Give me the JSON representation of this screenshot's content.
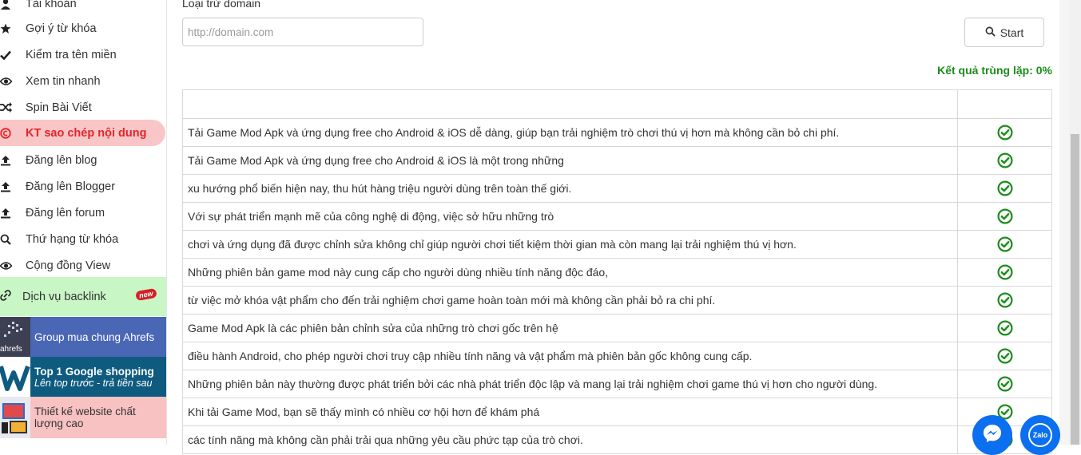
{
  "sidebar": {
    "items": [
      {
        "label": "Tài khoản",
        "icon": "user-icon"
      },
      {
        "label": "Gợi ý từ khóa",
        "icon": "star-icon"
      },
      {
        "label": "Kiểm tra tên miền",
        "icon": "check-icon"
      },
      {
        "label": "Xem tin nhanh",
        "icon": "eye-icon"
      },
      {
        "label": "Spin Bài Viết",
        "icon": "shuffle-icon"
      },
      {
        "label": "KT sao chép nội dung",
        "icon": "copyright-icon",
        "active": true
      },
      {
        "label": "Đăng lên blog",
        "icon": "upload-icon"
      },
      {
        "label": "Đăng lên Blogger",
        "icon": "upload-icon"
      },
      {
        "label": "Đăng lên forum",
        "icon": "upload-icon"
      },
      {
        "label": "Thứ hạng từ khóa",
        "icon": "search-icon"
      },
      {
        "label": "Cộng đồng View",
        "icon": "eye-icon"
      }
    ],
    "backlink": {
      "label": "Dịch vụ backlink",
      "badge": "new",
      "icon": "link-icon"
    },
    "promos": [
      {
        "title": "Group mua chung Ahrefs",
        "image_text": "ahrefs"
      },
      {
        "title": "Top 1 Google shopping",
        "subtitle": "Lên top trước - trả tiền sau"
      },
      {
        "title": "Thiết kế website chất lượng cao"
      }
    ]
  },
  "form": {
    "exclude_label": "Loại trừ domain",
    "domain_placeholder": "http://domain.com",
    "start_label": "Start"
  },
  "result_text": "Kết quả trùng lặp: 0%",
  "rows": [
    "Tải Game Mod Apk và ứng dụng free cho Android & iOS dễ dàng, giúp bạn trải nghiệm trò chơi thú vị hơn mà không cần bỏ chi phí.",
    "Tải Game Mod Apk và ứng dụng free cho Android & iOS là một trong những",
    "xu hướng phổ biến hiện nay, thu hút hàng triệu người dùng trên toàn thế giới.",
    "Với sự phát triển mạnh mẽ của công nghệ di động, việc sở hữu những trò",
    "chơi và ứng dụng đã được chỉnh sửa không chỉ giúp người chơi tiết kiệm thời gian mà còn mang lại trải nghiệm thú vị hơn.",
    "Những phiên bản game mod này cung cấp cho người dùng nhiều tính năng độc đáo,",
    "từ việc mở khóa vật phẩm cho đến trải nghiệm chơi game hoàn toàn mới mà không cần phải bỏ ra chi phí.",
    "Game Mod Apk là các phiên bản chỉnh sửa của những trò chơi gốc trên hệ",
    "điều hành Android, cho phép người chơi truy cập nhiều tính năng và vật phẩm mà phiên bản gốc không cung cấp.",
    "Những phiên bản này thường được phát triển bởi các nhà phát triển độc lập và mang lại trải nghiệm chơi game thú vị hơn cho người dùng.",
    "Khi tải Game Mod, bạn sẽ thấy mình có nhiều cơ hội hơn để khám phá",
    "các tính năng mà không cần phải trải qua những yêu cầu phức tạp của trò chơi."
  ],
  "colors": {
    "accent_red": "#e2262b",
    "active_bg": "#f8c6c6",
    "success": "#1c8b1c",
    "backlink_bg": "#c8f7c5",
    "ahrefs_bg": "#4a67b6",
    "shopping_bg": "#0e5b7f",
    "website_bg": "#f8c2c2"
  },
  "fab": {
    "zalo_label": "Zalo",
    "messenger_icon": "messenger-icon"
  }
}
